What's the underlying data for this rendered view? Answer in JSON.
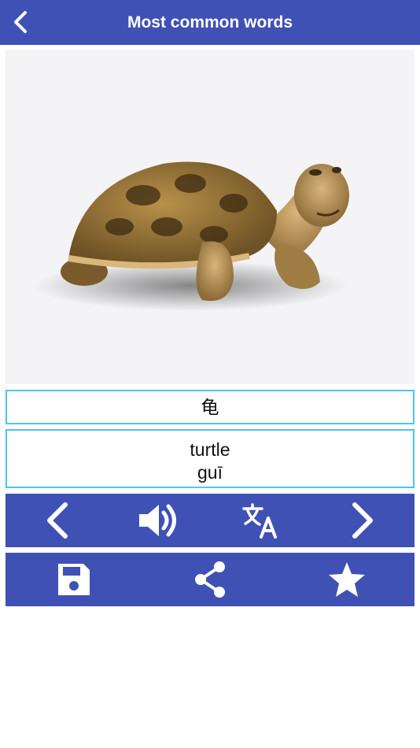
{
  "header": {
    "title": "Most common words",
    "back_icon": "chevron-left-icon"
  },
  "image": {
    "subject": "turtle-illustration"
  },
  "word": {
    "chinese": "龟"
  },
  "translation": {
    "english": "turtle",
    "pinyin": "guī"
  },
  "controls_row1": [
    "previous-icon",
    "speaker-icon",
    "translate-icon",
    "next-icon"
  ],
  "controls_row2": [
    "save-icon",
    "share-icon",
    "star-icon"
  ],
  "colors": {
    "primary": "#3f51b5",
    "border_accent": "#4fc3f7",
    "image_bg": "#f4f4f6"
  }
}
